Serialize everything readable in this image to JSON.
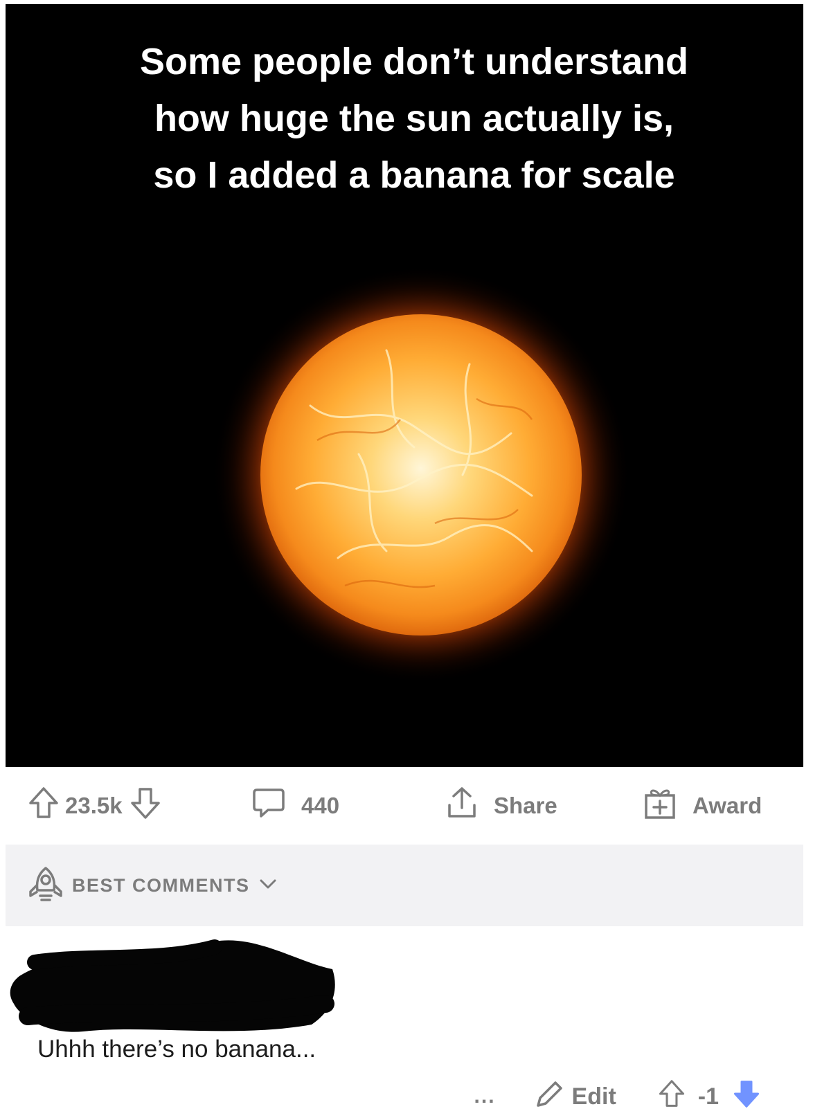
{
  "post": {
    "caption_lines": [
      "Some people don’t understand",
      "how huge the sun actually is,",
      "so I added a banana for scale"
    ],
    "image_subject": "sun",
    "votes": "23.5k",
    "comments_count": "440",
    "share_label": "Share",
    "award_label": "Award"
  },
  "sort": {
    "label": "BEST COMMENTS",
    "icon": "rocket-icon"
  },
  "comment": {
    "body": "Uhhh there’s no banana...",
    "more_label": "...",
    "edit_label": "Edit",
    "score": "-1",
    "downvoted": true
  },
  "colors": {
    "meta_gray": "#7c7c7c",
    "downvote_active": "#7193ff",
    "sort_bar_bg": "#f2f2f4",
    "image_bg": "#000000"
  }
}
